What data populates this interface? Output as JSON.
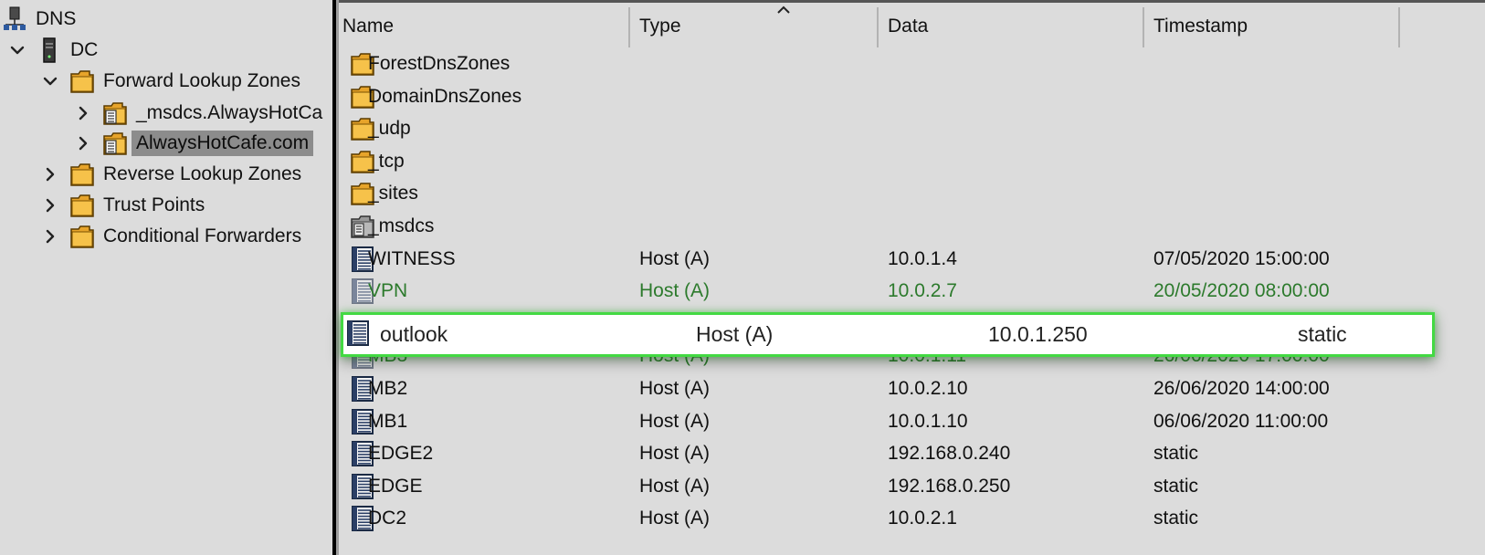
{
  "tree": {
    "items": [
      {
        "label": "DNS",
        "icon": "dns-server-icon",
        "level": 0,
        "expander": "none"
      },
      {
        "label": "DC",
        "icon": "server-icon",
        "level": 1,
        "expander": "expanded"
      },
      {
        "label": "Forward Lookup Zones",
        "icon": "folder-icon",
        "level": 2,
        "expander": "expanded"
      },
      {
        "label": "_msdcs.AlwaysHotCa",
        "icon": "zone-icon",
        "level": 3,
        "expander": "collapsed"
      },
      {
        "label": "AlwaysHotCafe.com",
        "icon": "zone-icon",
        "level": 3,
        "expander": "collapsed",
        "selected": true
      },
      {
        "label": "Reverse Lookup Zones",
        "icon": "folder-icon",
        "level": 2,
        "expander": "collapsed"
      },
      {
        "label": "Trust Points",
        "icon": "folder-icon",
        "level": 2,
        "expander": "collapsed"
      },
      {
        "label": "Conditional Forwarders",
        "icon": "folder-icon",
        "level": 2,
        "expander": "collapsed"
      }
    ]
  },
  "list": {
    "columns": [
      "Name",
      "Type",
      "Data",
      "Timestamp"
    ],
    "sorted_column": "Type",
    "rows": [
      {
        "name": "ForestDnsZones",
        "type": "",
        "data": "",
        "timestamp": "",
        "icon": "folder-icon"
      },
      {
        "name": "DomainDnsZones",
        "type": "",
        "data": "",
        "timestamp": "",
        "icon": "folder-icon"
      },
      {
        "name": "_udp",
        "type": "",
        "data": "",
        "timestamp": "",
        "icon": "folder-icon"
      },
      {
        "name": "_tcp",
        "type": "",
        "data": "",
        "timestamp": "",
        "icon": "folder-icon"
      },
      {
        "name": "_sites",
        "type": "",
        "data": "",
        "timestamp": "",
        "icon": "folder-icon"
      },
      {
        "name": "_msdcs",
        "type": "",
        "data": "",
        "timestamp": "",
        "icon": "delegation-icon"
      },
      {
        "name": "WITNESS",
        "type": "Host (A)",
        "data": "10.0.1.4",
        "timestamp": "07/05/2020 15:00:00",
        "icon": "record-icon"
      },
      {
        "name": "VPN",
        "type": "Host (A)",
        "data": "10.0.2.7",
        "timestamp": "20/05/2020 08:00:00",
        "icon": "record-icon",
        "tint": "green"
      },
      {
        "name": "outlook",
        "type": "Host (A)",
        "data": "10.0.1.250",
        "timestamp": "static",
        "icon": "record-icon",
        "highlight": true
      },
      {
        "name": "MB3",
        "type": "Host (A)",
        "data": "10.0.1.11",
        "timestamp": "26/06/2020 17:00:00",
        "icon": "record-icon",
        "tint": "green"
      },
      {
        "name": "MB2",
        "type": "Host (A)",
        "data": "10.0.2.10",
        "timestamp": "26/06/2020 14:00:00",
        "icon": "record-icon"
      },
      {
        "name": "MB1",
        "type": "Host (A)",
        "data": "10.0.1.10",
        "timestamp": "06/06/2020 11:00:00",
        "icon": "record-icon"
      },
      {
        "name": "EDGE2",
        "type": "Host (A)",
        "data": "192.168.0.240",
        "timestamp": "static",
        "icon": "record-icon"
      },
      {
        "name": "EDGE",
        "type": "Host (A)",
        "data": "192.168.0.250",
        "timestamp": "static",
        "icon": "record-icon"
      },
      {
        "name": "DC2",
        "type": "Host (A)",
        "data": "10.0.2.1",
        "timestamp": "static",
        "icon": "record-icon"
      }
    ]
  },
  "colors": {
    "highlight_border": "#43d943",
    "green_text": "#2c7a2c",
    "selection_bg": "#8c8c8c",
    "folder": "#f0b43a"
  }
}
